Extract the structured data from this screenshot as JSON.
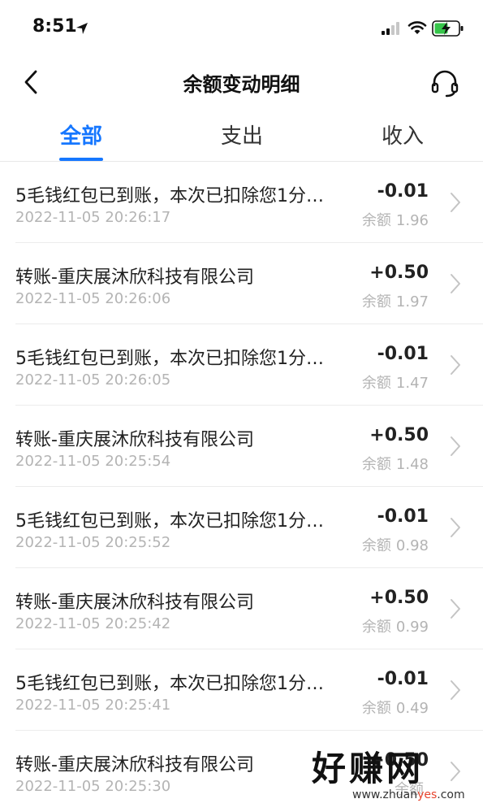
{
  "status_bar": {
    "time": "8:51"
  },
  "nav": {
    "title": "余额变动明细"
  },
  "tabs": [
    {
      "label": "全部",
      "active": true
    },
    {
      "label": "支出",
      "active": false
    },
    {
      "label": "收入",
      "active": false
    }
  ],
  "balance_label": "余额",
  "transactions": [
    {
      "title": "5毛钱红包已到账，本次已扣除您1分…",
      "time": "2022-11-05 20:26:17",
      "amount": "-0.01",
      "balance": "1.96"
    },
    {
      "title": "转账-重庆展沐欣科技有限公司",
      "time": "2022-11-05 20:26:06",
      "amount": "+0.50",
      "balance": "1.97"
    },
    {
      "title": "5毛钱红包已到账，本次已扣除您1分…",
      "time": "2022-11-05 20:26:05",
      "amount": "-0.01",
      "balance": "1.47"
    },
    {
      "title": "转账-重庆展沐欣科技有限公司",
      "time": "2022-11-05 20:25:54",
      "amount": "+0.50",
      "balance": "1.48"
    },
    {
      "title": "5毛钱红包已到账，本次已扣除您1分…",
      "time": "2022-11-05 20:25:52",
      "amount": "-0.01",
      "balance": "0.98"
    },
    {
      "title": "转账-重庆展沐欣科技有限公司",
      "time": "2022-11-05 20:25:42",
      "amount": "+0.50",
      "balance": "0.99"
    },
    {
      "title": "5毛钱红包已到账，本次已扣除您1分…",
      "time": "2022-11-05 20:25:41",
      "amount": "-0.01",
      "balance": "0.49"
    },
    {
      "title": "转账-重庆展沐欣科技有限公司",
      "time": "2022-11-05 20:25:30",
      "amount": "+0.50",
      "balance": ""
    }
  ],
  "watermark": {
    "main": "好赚网",
    "sub_prefix": "www.zhuan",
    "sub_accent": "yes",
    "sub_suffix": ".com"
  },
  "colors": {
    "accent": "#1677ff",
    "secondary_text": "#b4b4b4"
  }
}
